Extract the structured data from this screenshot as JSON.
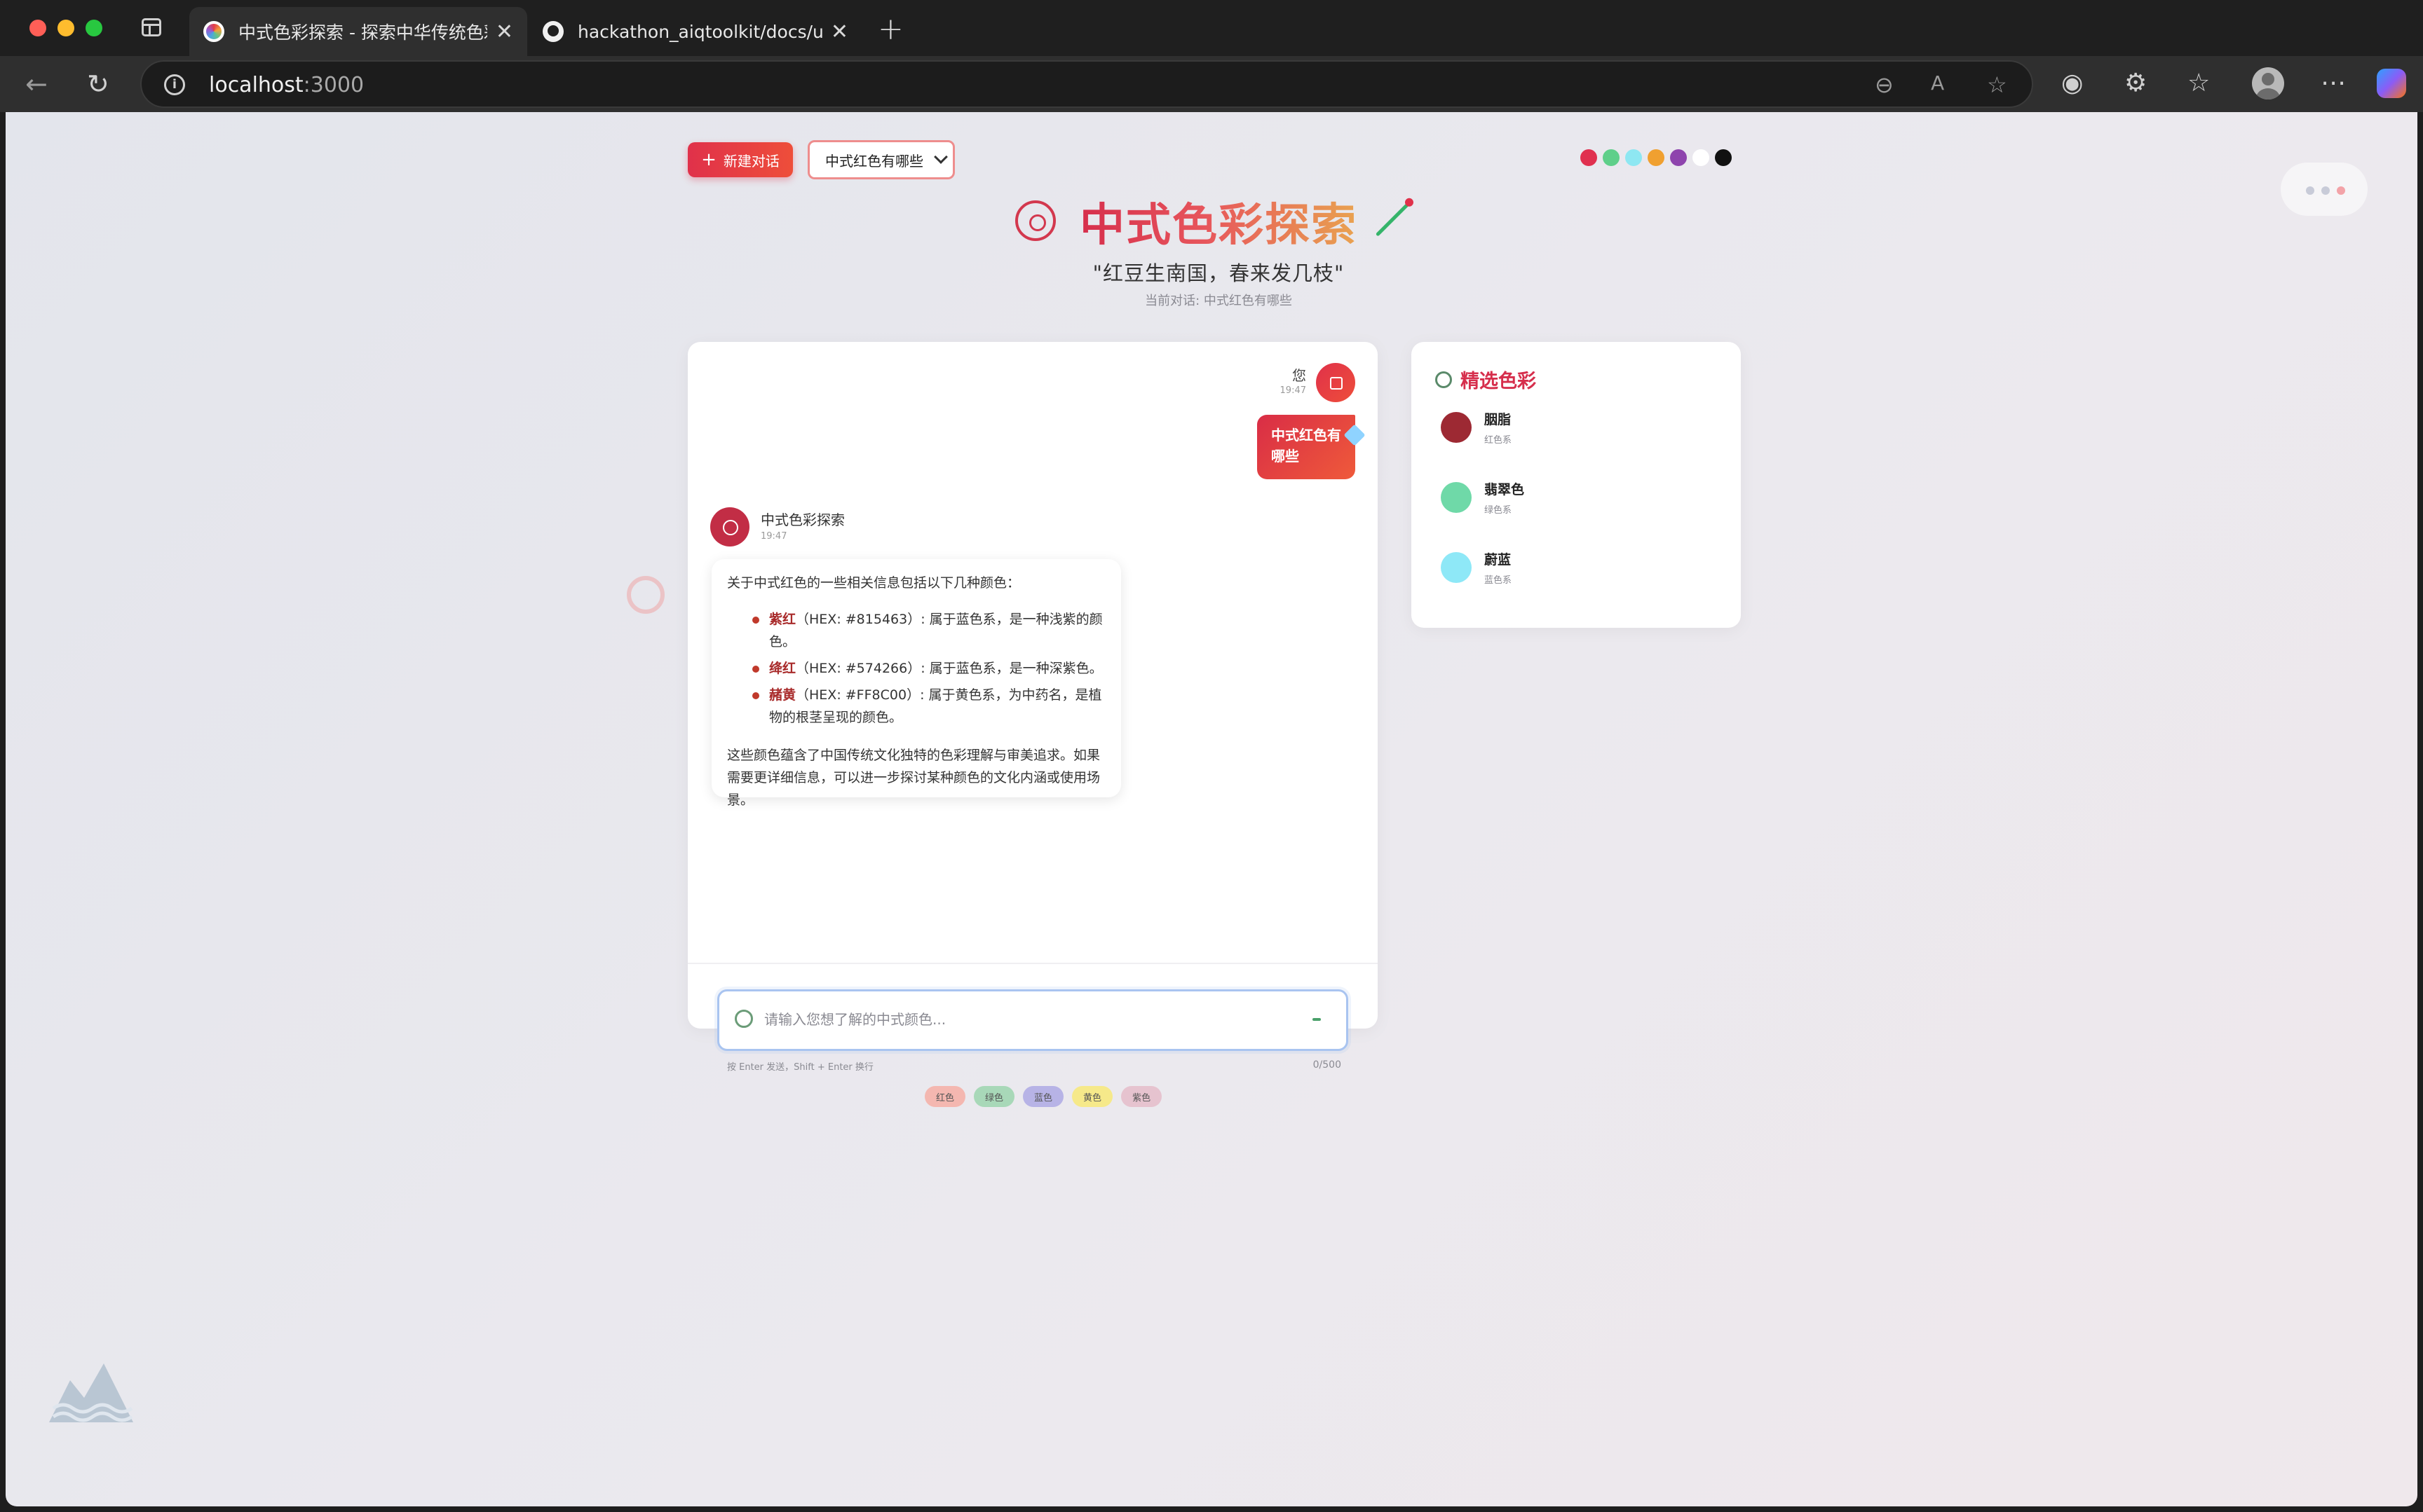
{
  "browser": {
    "tabs": [
      {
        "title": "中式色彩探索 - 探索中华传统色彩",
        "active": true
      },
      {
        "title": "hackathon_aiqtoolkit/docs/ui_s",
        "active": false
      }
    ],
    "url_host": "localhost",
    "url_port": ":3000"
  },
  "toolbar": {
    "new_chat_label": "新建对话",
    "conversation_select": "中式红色有哪些",
    "swatch_colors": [
      "#e0304f",
      "#5fcf8a",
      "#8ee7f2",
      "#f0a030",
      "#8e44ad",
      "#ffffff",
      "#111111"
    ]
  },
  "header": {
    "title": "中式色彩探索",
    "subtitle": "\"红豆生南国，春来发几枝\"",
    "current_conversation": "当前对话: 中式红色有哪些"
  },
  "chat": {
    "user": {
      "name": "您",
      "time": "19:47",
      "message": "中式红色有哪些"
    },
    "bot": {
      "name": "中式色彩探索",
      "time": "19:47",
      "intro": "关于中式红色的一些相关信息包括以下几种颜色：",
      "items": [
        {
          "name": "紫红",
          "desc": "（HEX: #815463）: 属于蓝色系，是一种浅紫的颜色。"
        },
        {
          "name": "绛红",
          "desc": "（HEX: #574266）: 属于蓝色系，是一种深紫色。"
        },
        {
          "name": "赭黄",
          "desc": "（HEX: #FF8C00）: 属于黄色系，为中药名，是植物的根茎呈现的颜色。"
        }
      ],
      "conclusion": "这些颜色蕴含了中国传统文化独特的色彩理解与审美追求。如果需要更详细信息，可以进一步探讨某种颜色的文化内涵或使用场景。"
    }
  },
  "input": {
    "placeholder": "请输入您想了解的中式颜色...",
    "hint": "按 Enter 发送，Shift + Enter 换行",
    "char_count": "0/500",
    "quick_tags": [
      {
        "label": "红色",
        "color": "#f4b7b0"
      },
      {
        "label": "绿色",
        "color": "#a8d8b8"
      },
      {
        "label": "蓝色",
        "color": "#b7b3e6"
      },
      {
        "label": "黄色",
        "color": "#f6e98a"
      },
      {
        "label": "紫色",
        "color": "#e6c3cf"
      }
    ]
  },
  "featured": {
    "title": "精选色彩",
    "colors": [
      {
        "name": "胭脂",
        "family": "红色系",
        "hex": "#9d2933"
      },
      {
        "name": "翡翠色",
        "family": "绿色系",
        "hex": "#6fd9a8"
      },
      {
        "name": "蔚蓝",
        "family": "蓝色系",
        "hex": "#8ee8f7"
      }
    ]
  }
}
